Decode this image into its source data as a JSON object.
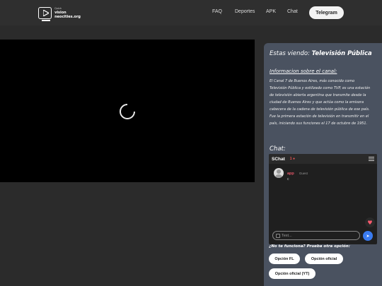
{
  "header": {
    "logo_lines": [
      "Quick",
      "vision",
      "neocities.org"
    ],
    "nav": [
      {
        "label": "FAQ"
      },
      {
        "label": "Deportes"
      },
      {
        "label": "APK"
      },
      {
        "label": "Chat"
      }
    ],
    "telegram_label": "Telegram"
  },
  "player": {
    "state": "loading"
  },
  "panel": {
    "watching_prefix": "Estas viendo:",
    "channel_name": "Televisión Pública",
    "info_title": "Informacion sobre el canal:",
    "info_text": "El Canal 7 de Buenos Aires, más conocido como Televisión Pública y estilizado como TVP, es una estación de televisión abierta argentina que transmite desde la ciudad de Buenos Aires y que actúa como la emisora cabecera de la cadena de televisión pública de ese país. Fue la primera estación de televisión en transmitir en el país, iniciando sus funciones el 17 de octubre de 1951.",
    "chat_title": "Chat:"
  },
  "chat": {
    "brand": "SChat",
    "online_count": "1",
    "messages": [
      {
        "user": "app",
        "role": "Guest",
        "text": "c"
      }
    ],
    "input_placeholder": "Text...",
    "heart_icon": "heart-icon",
    "send_icon": "send-icon"
  },
  "alternatives": {
    "prompt": "¿No te funciona? Prueba otra opción:",
    "options": [
      {
        "label": "Opción FL"
      },
      {
        "label": "Opción oficial"
      },
      {
        "label": "Opción oficial (YT)"
      }
    ]
  },
  "colors": {
    "page_bg": "#2b2b2b",
    "panel_bg": "#4a5260",
    "send_accent": "#3a7bf0",
    "heart": "#ff5a6e"
  }
}
